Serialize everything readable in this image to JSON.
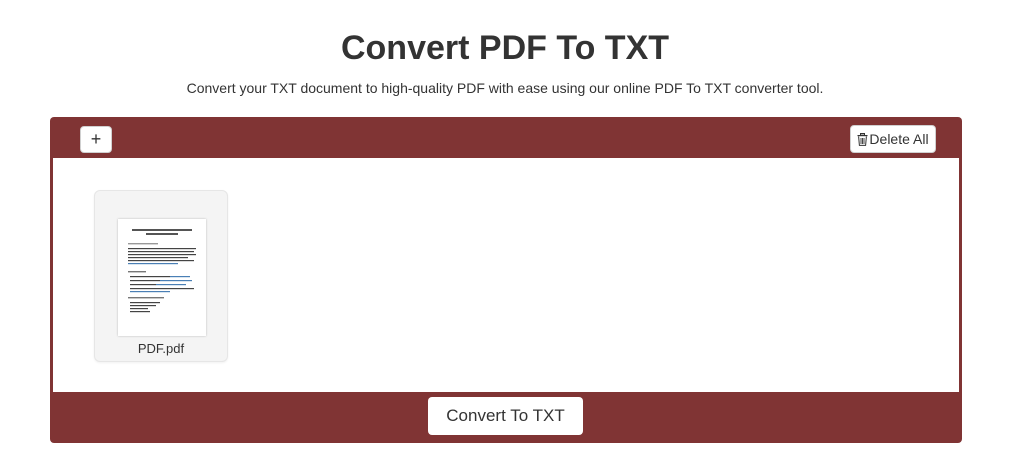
{
  "header": {
    "title": "Convert PDF To TXT",
    "subtitle": "Convert your TXT document to high-quality PDF with ease using our online PDF To TXT converter tool."
  },
  "toolbar": {
    "add_label": "+",
    "add_icon": "plus-icon",
    "delete_icon": "trash-icon",
    "delete_label": "Delete All"
  },
  "files": [
    {
      "name": "PDF.pdf",
      "thumbnail_icon": "pdf-page-thumbnail"
    }
  ],
  "actions": {
    "convert_label": "Convert To TXT"
  },
  "colors": {
    "panel": "#803434",
    "surface": "#ffffff",
    "text": "#333333"
  }
}
